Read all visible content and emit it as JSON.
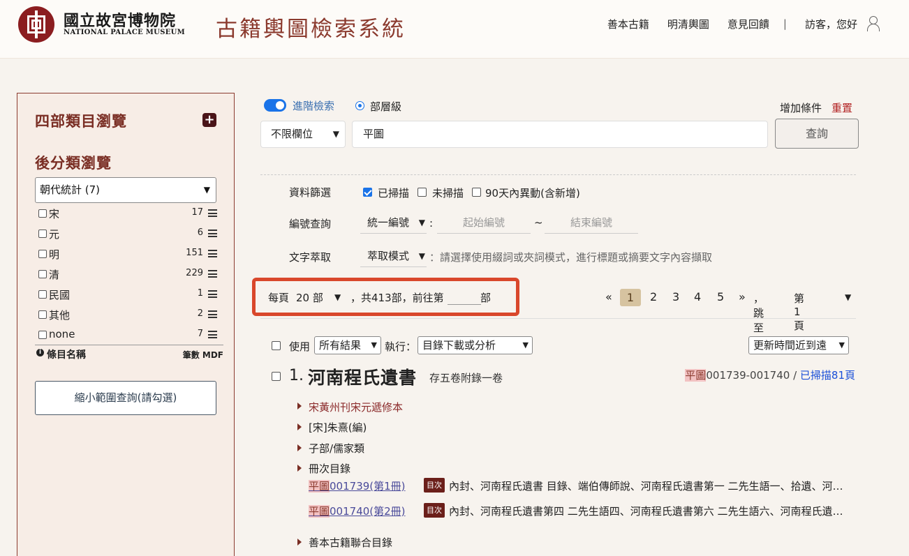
{
  "header": {
    "logo_cn": "國立故宮博物院",
    "logo_en": "NATIONAL PALACE MUSEUM",
    "site_title": "古籍輿圖檢索系統",
    "nav": [
      "善本古籍",
      "明清輿圖",
      "意見回饋"
    ],
    "separator": "|",
    "greeting": "訪客，您好"
  },
  "sidebar": {
    "title1": "四部類目瀏覽",
    "plus": "+",
    "title2": "後分類瀏覽",
    "select_value": "朝代統計 (7)",
    "dynasties": [
      {
        "label": "宋",
        "count": "17"
      },
      {
        "label": "元",
        "count": "6"
      },
      {
        "label": "明",
        "count": "151"
      },
      {
        "label": "清",
        "count": "229"
      },
      {
        "label": "民國",
        "count": "1"
      },
      {
        "label": "其他",
        "count": "2"
      },
      {
        "label": "none",
        "count": "7"
      }
    ],
    "footer_left": "條目名稱",
    "footer_right": "筆數 MDF",
    "narrow_button": "縮小範圍查詢(請勾選)"
  },
  "search": {
    "advanced_label": "進階檢索",
    "level_label": "部層級",
    "add_condition": "增加條件",
    "reset": "重置",
    "field_select": "不限欄位",
    "query_value": "平圖",
    "query_button": "查詢"
  },
  "filters": {
    "data_filter_label": "資料篩選",
    "scanned": "已掃描",
    "unscanned": "未掃描",
    "changed": "90天內異動(含新增)",
    "id_query_label": "編號查詢",
    "id_type": "統一編號",
    "colon": ":",
    "start_placeholder": "起始編號",
    "tilde": "~",
    "end_placeholder": "結束編號",
    "extract_label": "文字萃取",
    "extract_mode": "萃取模式",
    "extract_hint": "：請選擇使用綴詞或夾詞模式，進行標題或摘要文字內容擷取"
  },
  "pagination": {
    "per_page_prefix": "每頁",
    "per_page_value": "20 部",
    "total_text": "，共413部，前往第",
    "unit": "部",
    "prev": "«",
    "pages": [
      "1",
      "2",
      "3",
      "4",
      "5"
    ],
    "next": "»",
    "jump_label": "，跳至",
    "jump_value": "第1頁"
  },
  "toolbar": {
    "use_label": "使用",
    "scope_value": "所有結果",
    "exec_label": "執行：",
    "action_value": "目錄下載或分析",
    "sort_value": "更新時間近到遠"
  },
  "result": {
    "number": "1.",
    "title": "河南程氏遺書",
    "subtitle": "存五卷附錄一卷",
    "id_prefix": "平圖",
    "id_range": "001739-001740",
    "id_sep": " / ",
    "scanned_link": "已掃描81頁",
    "edition": "宋黃州刊宋元遞修本",
    "author": "[宋]朱熹(編)",
    "category": "子部/儒家類",
    "volumes_label": "冊次目錄",
    "volumes": [
      {
        "prefix": "平圖",
        "id": "001739(第1冊)",
        "badge": "目次",
        "toc": "內封、河南程氏遺書 目錄、端伯傳師說、河南程氏遺書第一 二先生語一、拾遺、河南程氏遺書第二"
      },
      {
        "prefix": "平圖",
        "id": "001740(第2冊)",
        "badge": "目次",
        "toc": "內封、河南程氏遺書第四 二先生語四、河南程氏遺書第六 二先生語六、河南程氏遺書第七"
      }
    ],
    "union_catalog": "善本古籍聯合目錄"
  }
}
